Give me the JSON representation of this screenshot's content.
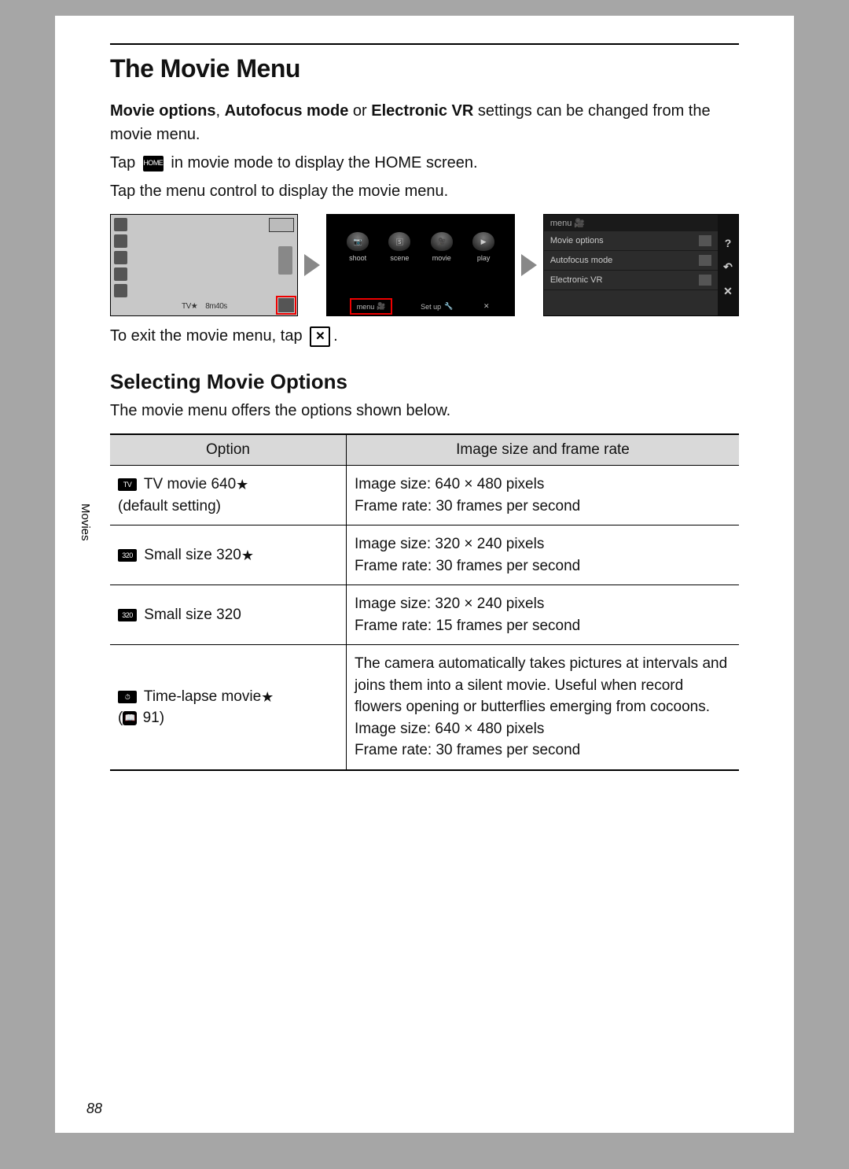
{
  "page_title": "The Movie Menu",
  "intro_bold1": "Movie options",
  "intro_comma": ", ",
  "intro_bold2": "Autofocus mode",
  "intro_or": " or ",
  "intro_bold3": "Electronic VR",
  "intro_rest": " settings can be changed from the movie menu.",
  "tap_line_pre": "Tap ",
  "tap_line_post": " in movie mode to display the HOME screen.",
  "tap_menu_line": "Tap the menu control to display the movie menu.",
  "home_icon_text": "HOME",
  "exit_line_pre": "To exit the movie menu, tap ",
  "exit_line_post": ".",
  "close_icon_text": "✕",
  "sub_heading": "Selecting Movie Options",
  "sub_text": "The movie menu offers the options shown below.",
  "th_option": "Option",
  "th_detail": "Image size and frame rate",
  "rows": [
    {
      "icon_text": "TV",
      "name": "TV movie 640",
      "star": "★",
      "note": "(default setting)",
      "detail": "Image size: 640 × 480 pixels\nFrame rate: 30 frames per second"
    },
    {
      "icon_text": "320",
      "name": "Small size 320",
      "star": "★",
      "note": "",
      "detail": "Image size: 320 × 240 pixels\nFrame rate: 30 frames per second"
    },
    {
      "icon_text": "320",
      "name": "Small size 320",
      "star": "",
      "note": "",
      "detail": "Image size: 320 × 240 pixels\nFrame rate: 15 frames per second"
    },
    {
      "icon_text": "⏱",
      "name": "Time-lapse movie",
      "star": "★",
      "note": "(📖 91)",
      "detail": "The camera automatically takes pictures at intervals and joins them into a silent movie. Useful when record flowers opening or butterflies emerging from cocoons.\nImage size: 640 × 480 pixels\nFrame rate: 30 frames per second"
    }
  ],
  "screenA_info1": "TV★",
  "screenA_info2": "8m40s",
  "screenB_modes": [
    "shoot",
    "scene",
    "movie",
    "play"
  ],
  "screenB_menu": "menu",
  "screenB_setup": "Set up",
  "screenB_x": "✕",
  "screenC_title": "menu 🎥",
  "screenC_items": [
    "Movie options",
    "Autofocus mode",
    "Electronic VR"
  ],
  "screenC_side": [
    "?",
    "↶",
    "✕"
  ],
  "side_label": "Movies",
  "page_number": "88",
  "page_ref_text": "91"
}
